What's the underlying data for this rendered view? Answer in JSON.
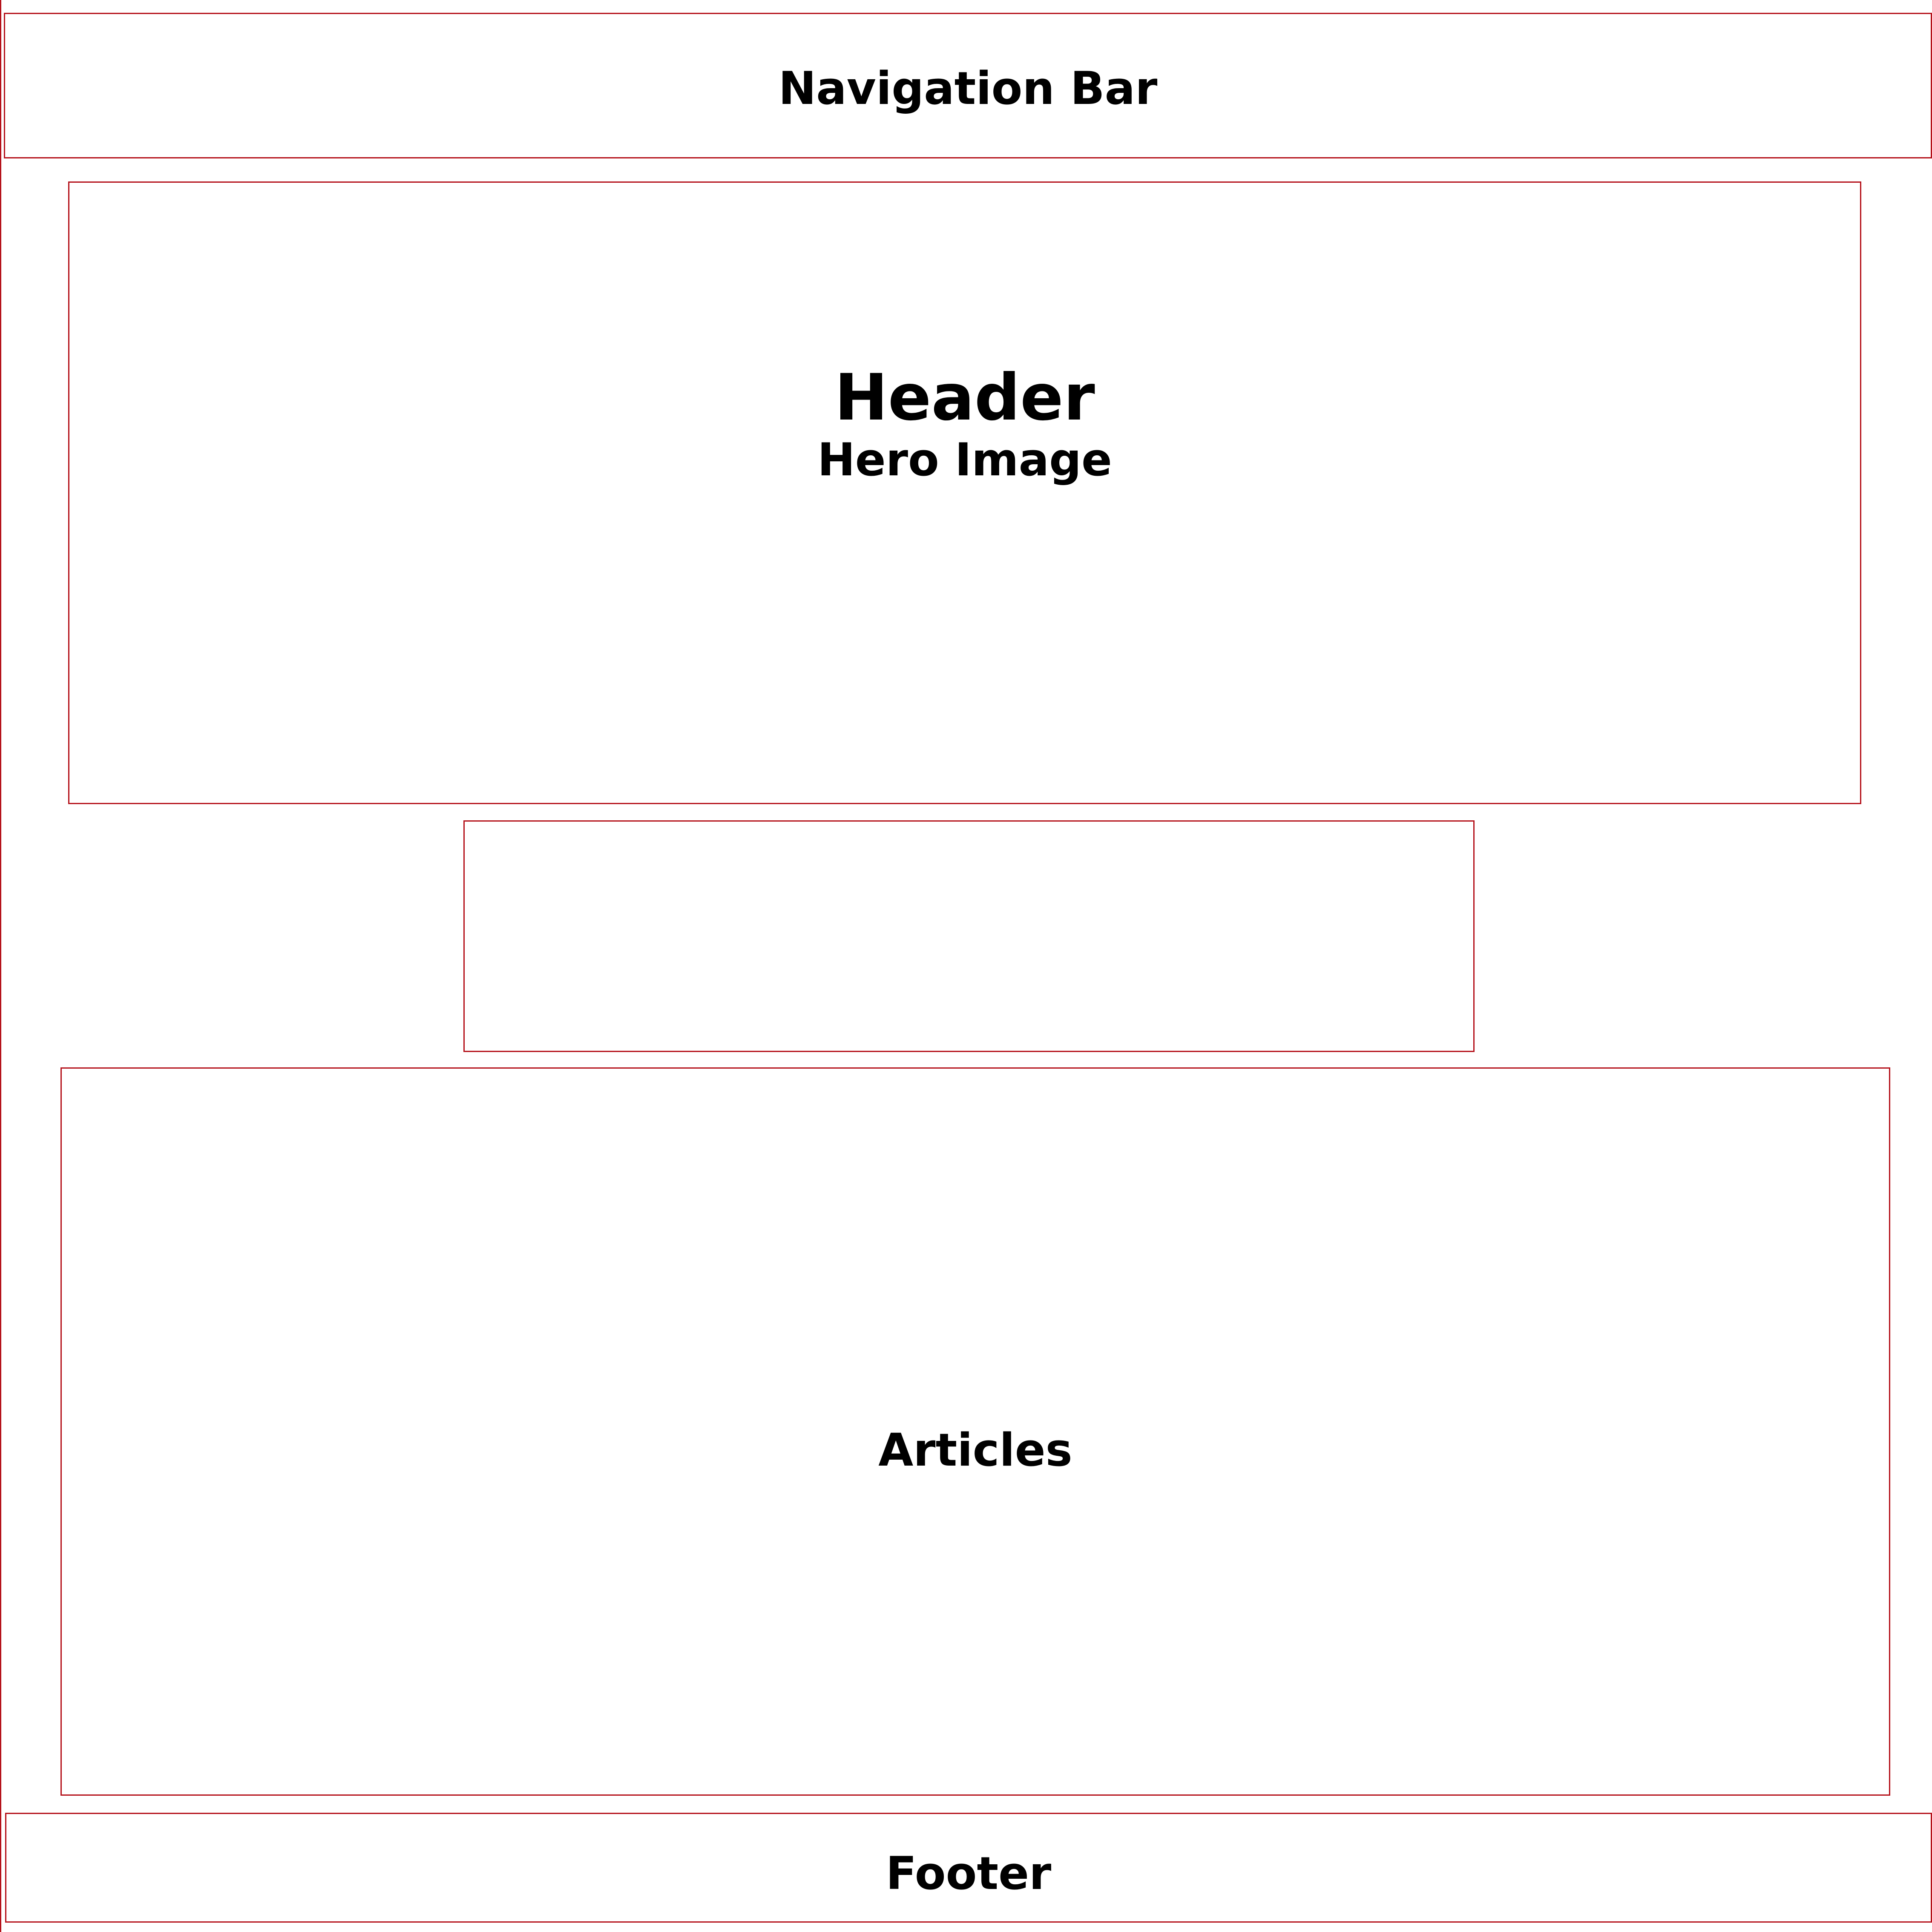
{
  "colors": {
    "outline": "#b5121b",
    "text": "#000000",
    "background": "#ffffff"
  },
  "navigation": {
    "label": "Navigation Bar"
  },
  "header": {
    "title": "Header",
    "subtitle": "Hero Image"
  },
  "middle": {
    "label": ""
  },
  "articles": {
    "label": "Articles"
  },
  "footer": {
    "label": "Footer"
  }
}
